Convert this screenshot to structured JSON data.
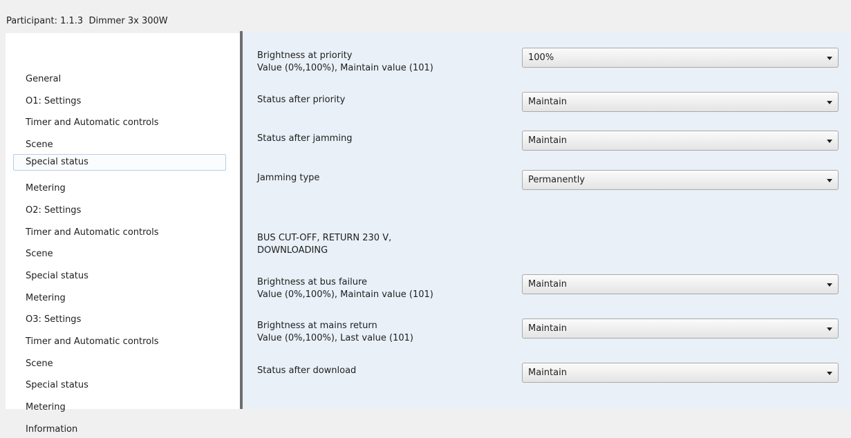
{
  "header": {
    "participant_label": "Participant: 1.1.3  Dimmer 3x 300W"
  },
  "sidebar": {
    "items": [
      {
        "label": "General"
      },
      {
        "label": "O1: Settings"
      },
      {
        "label": "Timer and Automatic controls"
      },
      {
        "label": "Scene"
      },
      {
        "label": "Special status"
      },
      {
        "label": "Metering"
      },
      {
        "label": "O2: Settings"
      },
      {
        "label": "Timer and Automatic controls"
      },
      {
        "label": "Scene"
      },
      {
        "label": "Special status"
      },
      {
        "label": "Metering"
      },
      {
        "label": "O3: Settings"
      },
      {
        "label": "Timer and Automatic controls"
      },
      {
        "label": "Scene"
      },
      {
        "label": "Special status"
      },
      {
        "label": "Metering"
      },
      {
        "label": "Information"
      }
    ],
    "selected_index": 4
  },
  "params": {
    "brightness_priority": {
      "label": "Brightness at priority",
      "sublabel": "Value (0%,100%), Maintain value (101)",
      "value": "100%"
    },
    "status_after_priority": {
      "label": "Status after priority",
      "value": "Maintain"
    },
    "status_after_jamming": {
      "label": "Status after jamming",
      "value": "Maintain"
    },
    "jamming_type": {
      "label": "Jamming type",
      "value": "Permanently"
    },
    "section_heading": {
      "line1": "BUS CUT-OFF, RETURN 230 V,",
      "line2": "DOWNLOADING"
    },
    "brightness_bus_failure": {
      "label": "Brightness at bus failure",
      "sublabel": "Value (0%,100%), Maintain value (101)",
      "value": "Maintain"
    },
    "brightness_mains_return": {
      "label": "Brightness at mains return",
      "sublabel": "Value (0%,100%), Last value (101)",
      "value": "Maintain"
    },
    "status_after_download": {
      "label": "Status after download",
      "value": "Maintain"
    }
  },
  "colors": {
    "panel_background": "#e9f0f7",
    "sidebar_background": "#ffffff",
    "selection_border": "#b4cde4"
  }
}
